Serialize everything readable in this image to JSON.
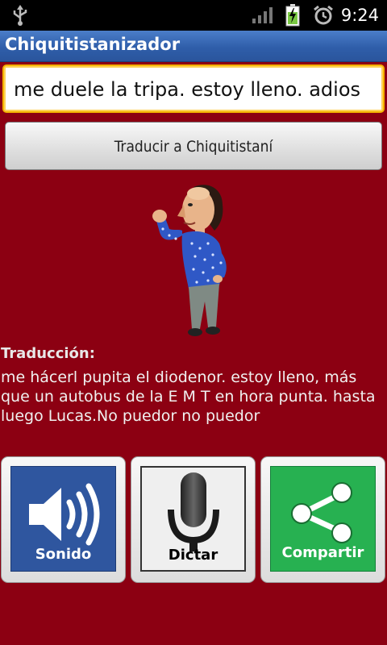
{
  "status_bar": {
    "time": "9:24",
    "icons": [
      "usb-icon",
      "signal-icon",
      "battery-charging-icon",
      "alarm-icon"
    ]
  },
  "app": {
    "title": "Chiquitistanizador"
  },
  "input": {
    "value": "me duele la tripa. estoy lleno. adios"
  },
  "translate_button": {
    "label": "Traducir a Chiquitistaní"
  },
  "translation": {
    "heading": "Traducción:",
    "text": "me hácerl pupita el diodenor. estoy  lleno, más que un autobus de la E M T en hora punta. hasta luego Lucas.No puedor no puedor"
  },
  "actions": [
    {
      "label": "Sonido",
      "icon": "speaker-icon",
      "color": "#2f569f"
    },
    {
      "label": "Dictar",
      "icon": "microphone-icon",
      "color": "#efefef"
    },
    {
      "label": "Compartir",
      "icon": "share-icon",
      "color": "#27b151"
    }
  ],
  "colors": {
    "background": "#8c0012",
    "title_bar": "#3465b3",
    "input_focus": "#f4b400"
  }
}
